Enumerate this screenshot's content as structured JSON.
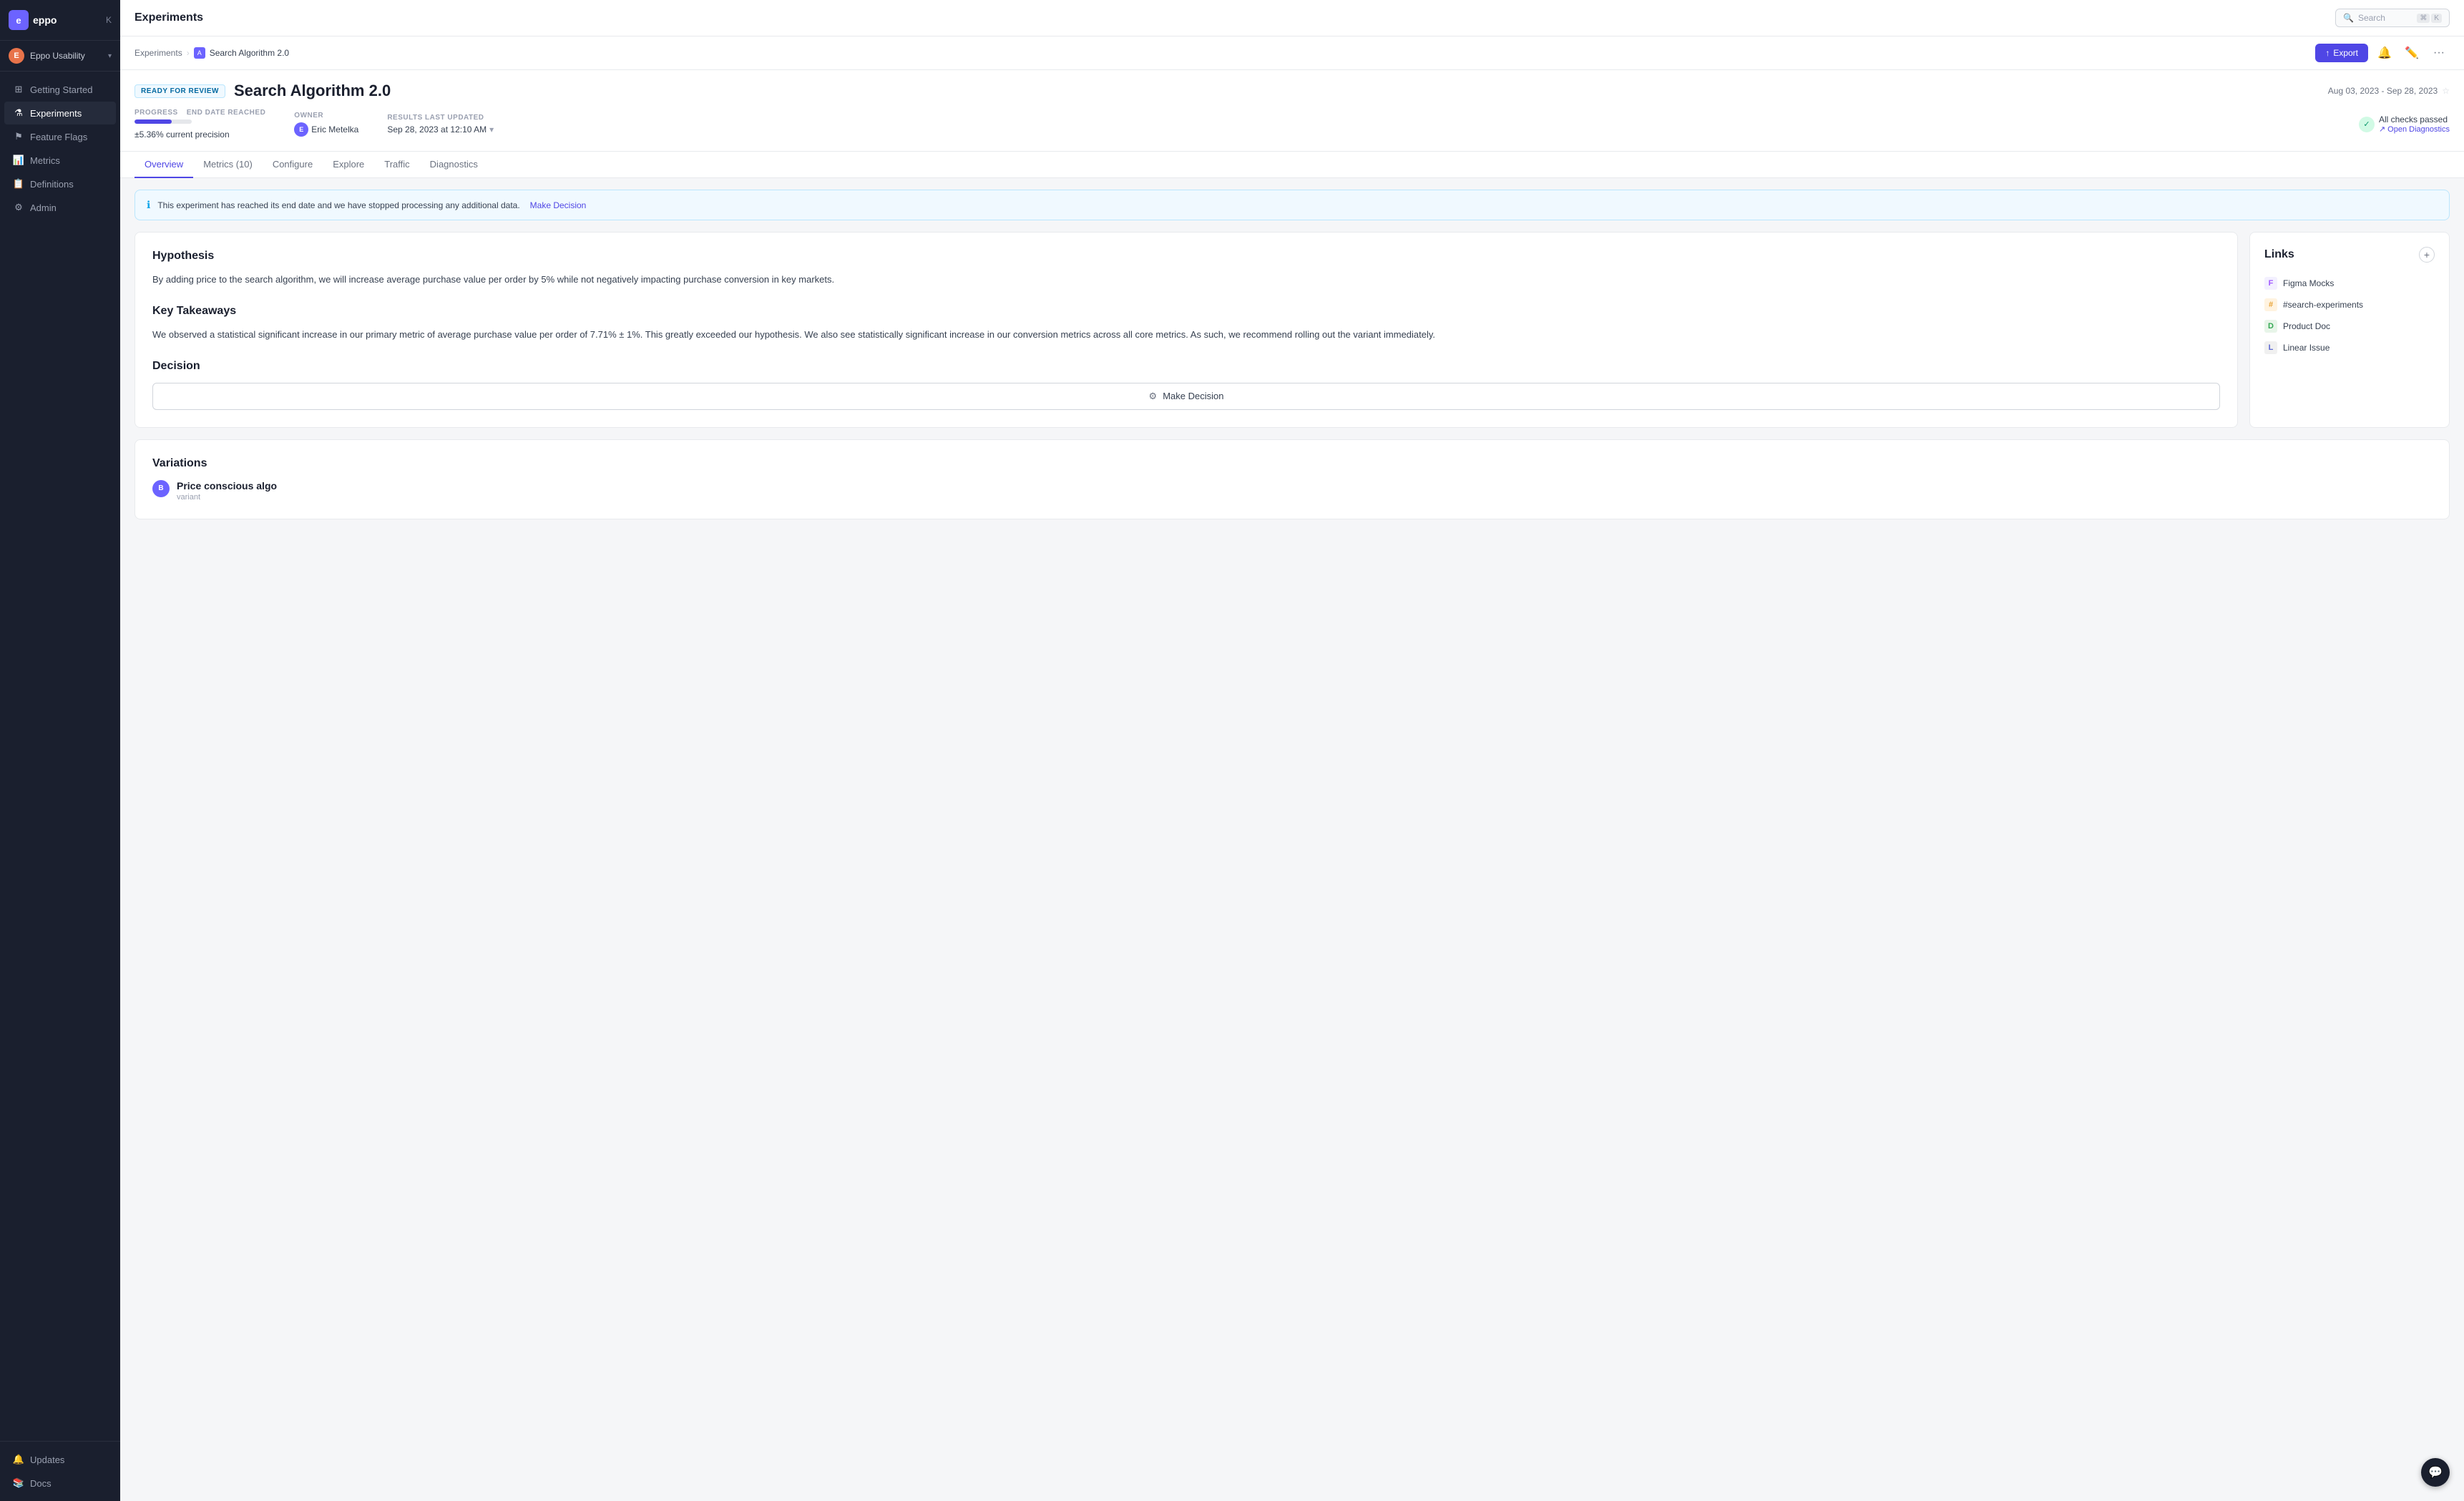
{
  "sidebar": {
    "logo_text": "eppo",
    "workspace_name": "Eppo Usability",
    "workspace_initial": "E",
    "collapse_label": "K",
    "nav_items": [
      {
        "id": "getting-started",
        "label": "Getting Started",
        "icon": "⊞",
        "active": false
      },
      {
        "id": "experiments",
        "label": "Experiments",
        "icon": "⚗",
        "active": true
      },
      {
        "id": "feature-flags",
        "label": "Feature Flags",
        "icon": "⚑",
        "active": false
      },
      {
        "id": "metrics",
        "label": "Metrics",
        "icon": "📊",
        "active": false
      },
      {
        "id": "definitions",
        "label": "Definitions",
        "icon": "📋",
        "active": false
      },
      {
        "id": "admin",
        "label": "Admin",
        "icon": "⚙",
        "active": false
      }
    ],
    "bottom_items": [
      {
        "id": "updates",
        "label": "Updates",
        "icon": "🔔"
      },
      {
        "id": "docs",
        "label": "Docs",
        "icon": "📚"
      }
    ]
  },
  "header": {
    "page_title": "Experiments",
    "search_placeholder": "Search",
    "shortcut_cmd": "⌘",
    "shortcut_k": "K"
  },
  "breadcrumb": {
    "parent": "Experiments",
    "current": "Search Algorithm 2.0",
    "icon_label": "A"
  },
  "breadcrumb_actions": {
    "export_label": "Export",
    "export_icon": "↑"
  },
  "experiment": {
    "status": "READY FOR REVIEW",
    "title": "Search Algorithm 2.0",
    "date_range": "Aug 03, 2023 - Sep 28, 2023",
    "progress_label": "PROGRESS",
    "end_date_label": "END DATE REACHED",
    "progress_value": 65,
    "progress_text": "±5.36% current precision",
    "owner_label": "OWNER",
    "owner_name": "Eric Metelka",
    "owner_initial": "E",
    "results_label": "RESULTS LAST UPDATED",
    "results_date": "Sep 28, 2023 at 12:10 AM",
    "checks_text": "All checks passed",
    "diagnostics_link": "Open Diagnostics"
  },
  "tabs": [
    {
      "id": "overview",
      "label": "Overview",
      "active": true
    },
    {
      "id": "metrics",
      "label": "Metrics (10)",
      "active": false
    },
    {
      "id": "configure",
      "label": "Configure",
      "active": false
    },
    {
      "id": "explore",
      "label": "Explore",
      "active": false
    },
    {
      "id": "traffic",
      "label": "Traffic",
      "active": false
    },
    {
      "id": "diagnostics",
      "label": "Diagnostics",
      "active": false
    }
  ],
  "banner": {
    "message": "This experiment has reached its end date and we have stopped processing any additional data.",
    "cta": "Make Decision"
  },
  "hypothesis": {
    "title": "Hypothesis",
    "text": "By adding price to the search algorithm, we will increase average purchase value per order by 5% while not negatively impacting purchase conversion in key markets."
  },
  "key_takeaways": {
    "title": "Key Takeaways",
    "text": "We observed a statistical significant increase in our primary metric of average purchase value per order of 7.71% ± 1%. This greatly exceeded our hypothesis. We also see statistically significant increase in our conversion metrics across all core metrics. As such, we recommend rolling out the variant immediately."
  },
  "decision": {
    "title": "Decision",
    "button_label": "Make Decision"
  },
  "links": {
    "title": "Links",
    "add_label": "+",
    "items": [
      {
        "id": "figma",
        "label": "Figma Mocks",
        "icon_type": "figma",
        "icon_char": "F"
      },
      {
        "id": "slack",
        "label": "#search-experiments",
        "icon_type": "slack",
        "icon_char": "#"
      },
      {
        "id": "gdoc",
        "label": "Product Doc",
        "icon_type": "gdoc",
        "icon_char": "D"
      },
      {
        "id": "linear",
        "label": "Linear Issue",
        "icon_type": "linear",
        "icon_char": "L"
      }
    ]
  },
  "variations": {
    "title": "Variations",
    "items": [
      {
        "id": "variant1",
        "name": "Price conscious algo",
        "label": "variant",
        "initial": "B"
      }
    ]
  }
}
